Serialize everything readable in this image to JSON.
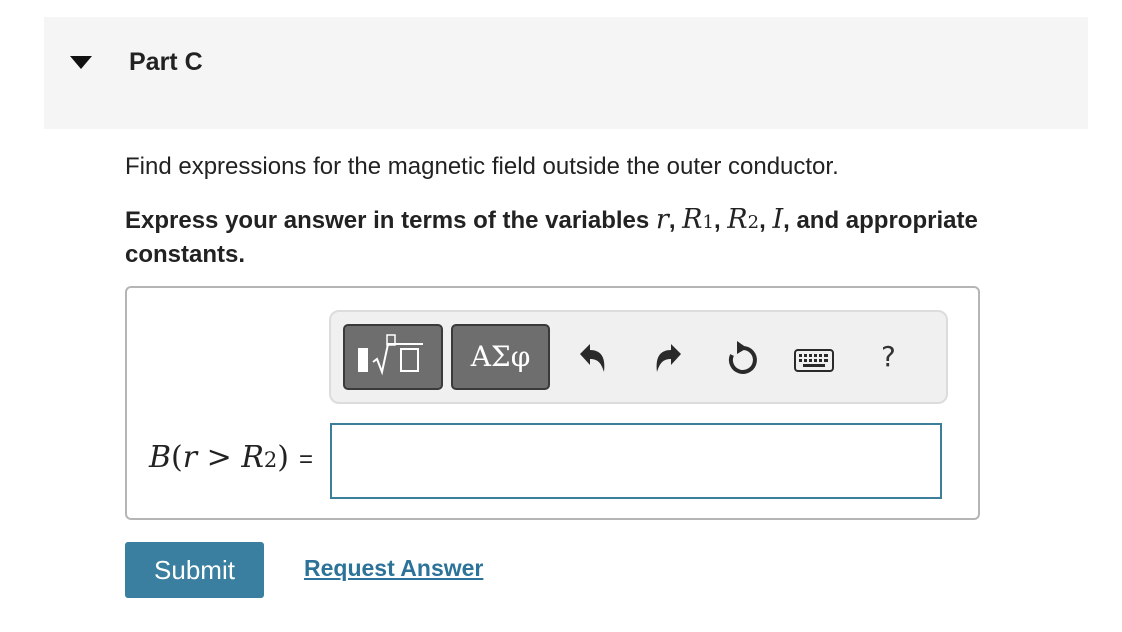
{
  "part": {
    "title": "Part C"
  },
  "question": {
    "text": "Find expressions for the magnetic field outside the outer conductor.",
    "instruction_prefix": "Express your answer in terms of the variables",
    "vars": {
      "r": "r",
      "R1_main": "R",
      "R1_sub": "1",
      "R2_main": "R",
      "R2_sub": "2",
      "I": "I"
    },
    "separator": ",",
    "instruction_and": ", and appropriate constants."
  },
  "toolbar": {
    "symbols_label": "ΑΣφ",
    "help_label": "?",
    "icons": [
      "templates-icon",
      "undo-icon",
      "redo-icon",
      "reset-icon",
      "keyboard-icon",
      "help-icon"
    ]
  },
  "answer": {
    "var_B": "B",
    "open_paren": "(",
    "var_r": "r",
    "gt": " > ",
    "var_R": "R",
    "sub_2": "2",
    "close_paren": ")",
    "equals": "=",
    "value": "",
    "placeholder": ""
  },
  "actions": {
    "submit_label": "Submit",
    "request_label": "Request Answer"
  },
  "colors": {
    "header_bg": "#f5f5f5",
    "input_border": "#3d7e9a",
    "submit_bg": "#3a7f9f",
    "link": "#2d7399"
  }
}
